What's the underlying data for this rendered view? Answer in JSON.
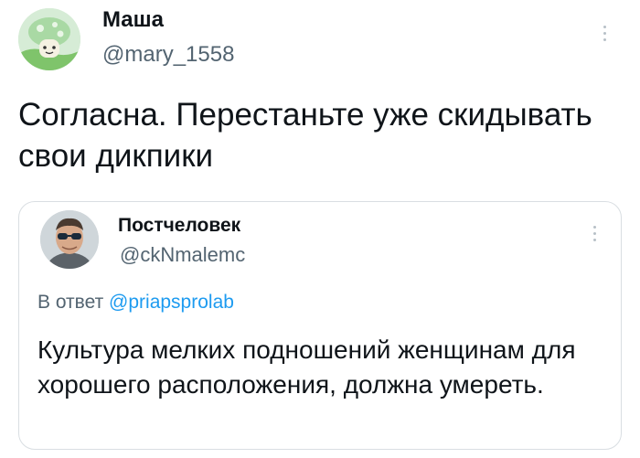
{
  "tweet": {
    "author_name": "Маша",
    "author_handle": "@mary_1558",
    "text": "Согласна. Перестаньте уже скидывать свои дикпики"
  },
  "quoted": {
    "author_name": "Постчеловек",
    "author_handle": "@ckNmalemc",
    "reply_prefix": "В ответ",
    "reply_to": "@priapsprolab",
    "text": "Культура мелких подношений женщинам для хорошего расположения, должна умереть."
  },
  "icons": {
    "menu": "more-vertical-icon",
    "avatar_main": "mushroom-avatar",
    "avatar_quote": "man-sunglasses-avatar"
  },
  "colors": {
    "text": "#0f1419",
    "muted": "#536471",
    "link": "#1d9bf0",
    "border": "#d9dee2"
  }
}
